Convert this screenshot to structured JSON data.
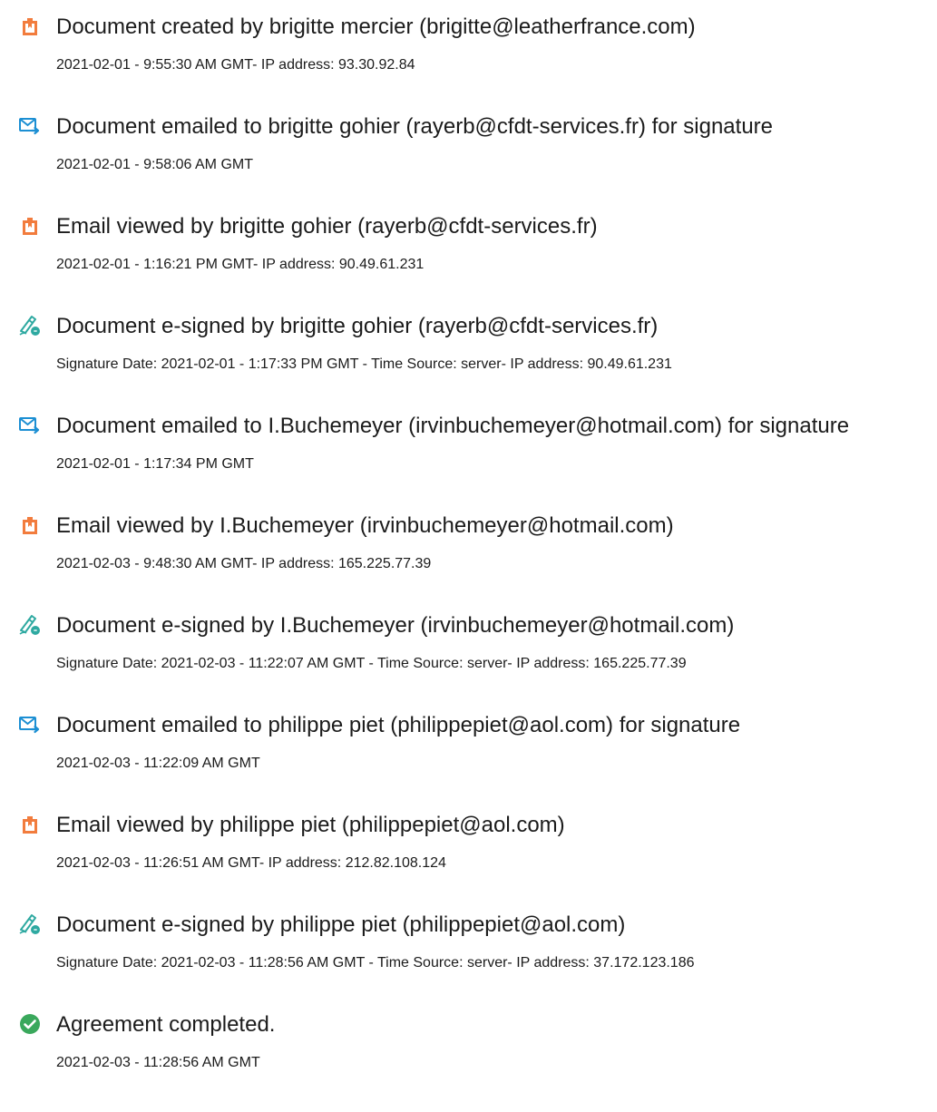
{
  "colors": {
    "document_icon": "#f27c3d",
    "email_icon": "#1c8fd3",
    "esign_icon": "#2ea9a1",
    "complete_icon": "#3aa85c"
  },
  "events": [
    {
      "icon": "document-icon",
      "title": "Document created by brigitte mercier (brigitte@leatherfrance.com)",
      "meta": "2021-02-01 - 9:55:30 AM GMT- IP address: 93.30.92.84"
    },
    {
      "icon": "email-sent-icon",
      "title": "Document emailed to brigitte gohier (rayerb@cfdt-services.fr) for signature",
      "meta": "2021-02-01 - 9:58:06 AM GMT"
    },
    {
      "icon": "document-icon",
      "title": "Email viewed by brigitte gohier (rayerb@cfdt-services.fr)",
      "meta": "2021-02-01 - 1:16:21 PM GMT- IP address: 90.49.61.231"
    },
    {
      "icon": "pen-signature-icon",
      "title": "Document e-signed by brigitte gohier (rayerb@cfdt-services.fr)",
      "meta": "Signature Date: 2021-02-01 - 1:17:33 PM GMT - Time Source: server- IP address: 90.49.61.231"
    },
    {
      "icon": "email-sent-icon",
      "title": "Document emailed to I.Buchemeyer (irvinbuchemeyer@hotmail.com) for signature",
      "meta": "2021-02-01 - 1:17:34 PM GMT"
    },
    {
      "icon": "document-icon",
      "title": "Email viewed by I.Buchemeyer (irvinbuchemeyer@hotmail.com)",
      "meta": "2021-02-03 - 9:48:30 AM GMT- IP address: 165.225.77.39"
    },
    {
      "icon": "pen-signature-icon",
      "title": "Document e-signed by I.Buchemeyer (irvinbuchemeyer@hotmail.com)",
      "meta": "Signature Date: 2021-02-03 - 11:22:07 AM GMT - Time Source: server- IP address: 165.225.77.39"
    },
    {
      "icon": "email-sent-icon",
      "title": "Document emailed to philippe piet (philippepiet@aol.com) for signature",
      "meta": "2021-02-03 - 11:22:09 AM GMT"
    },
    {
      "icon": "document-icon",
      "title": "Email viewed by philippe piet (philippepiet@aol.com)",
      "meta": "2021-02-03 - 11:26:51 AM GMT- IP address: 212.82.108.124"
    },
    {
      "icon": "pen-signature-icon",
      "title": "Document e-signed by philippe piet (philippepiet@aol.com)",
      "meta": "Signature Date: 2021-02-03 - 11:28:56 AM GMT - Time Source: server- IP address: 37.172.123.186"
    },
    {
      "icon": "check-circle-icon",
      "title": "Agreement completed.",
      "meta": "2021-02-03 - 11:28:56 AM GMT"
    }
  ]
}
